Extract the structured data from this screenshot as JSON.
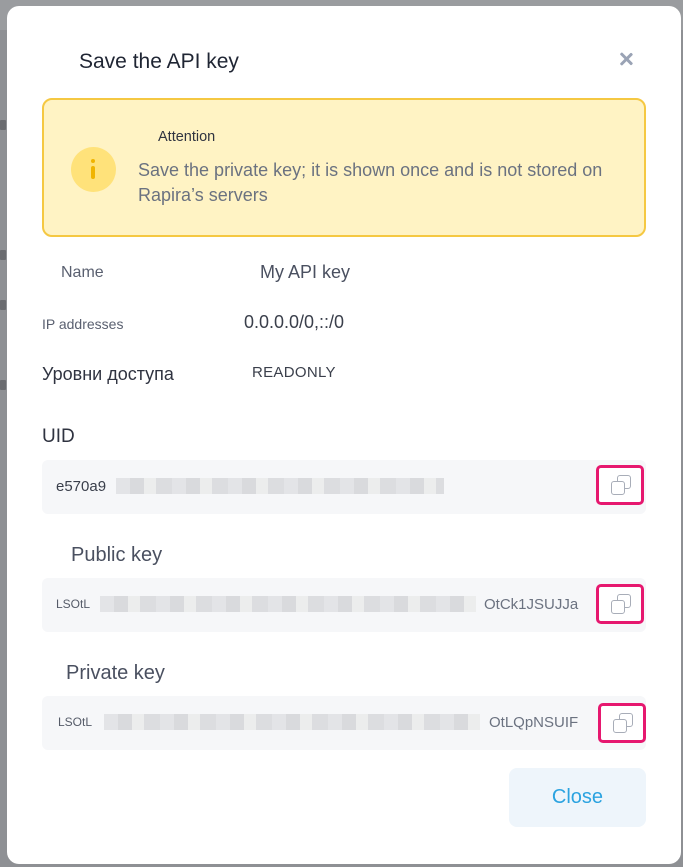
{
  "modal": {
    "title": "Save the API key",
    "close_icon": "close-icon"
  },
  "alert": {
    "icon": "info-icon",
    "title": "Attention",
    "text": "Save the private key; it is shown once and is not stored on Rapira’s servers"
  },
  "info": {
    "name_label": "Name",
    "name_value": "My API key",
    "ip_label": "IP addresses",
    "ip_value": "0.0.0.0/0,::/0",
    "access_label": "Уровни доступа",
    "access_value": "READONLY"
  },
  "keys": {
    "uid": {
      "label": "UID",
      "visible_start": "e570a9",
      "visible_end": "",
      "copy_icon": "copy-icon"
    },
    "public": {
      "label": "Public key",
      "visible_start": "LSOtL",
      "visible_end": "OtCk1JSUJJa",
      "copy_icon": "copy-icon"
    },
    "private": {
      "label": "Private key",
      "visible_start": "LSOtL",
      "visible_end": "OtLQpNSUIF",
      "copy_icon": "copy-icon"
    }
  },
  "footer": {
    "close_label": "Close"
  },
  "colors": {
    "alert_bg": "#fff3c4",
    "alert_border": "#f5c842",
    "copy_highlight": "#e6186f",
    "close_text": "#2ba3e0"
  }
}
